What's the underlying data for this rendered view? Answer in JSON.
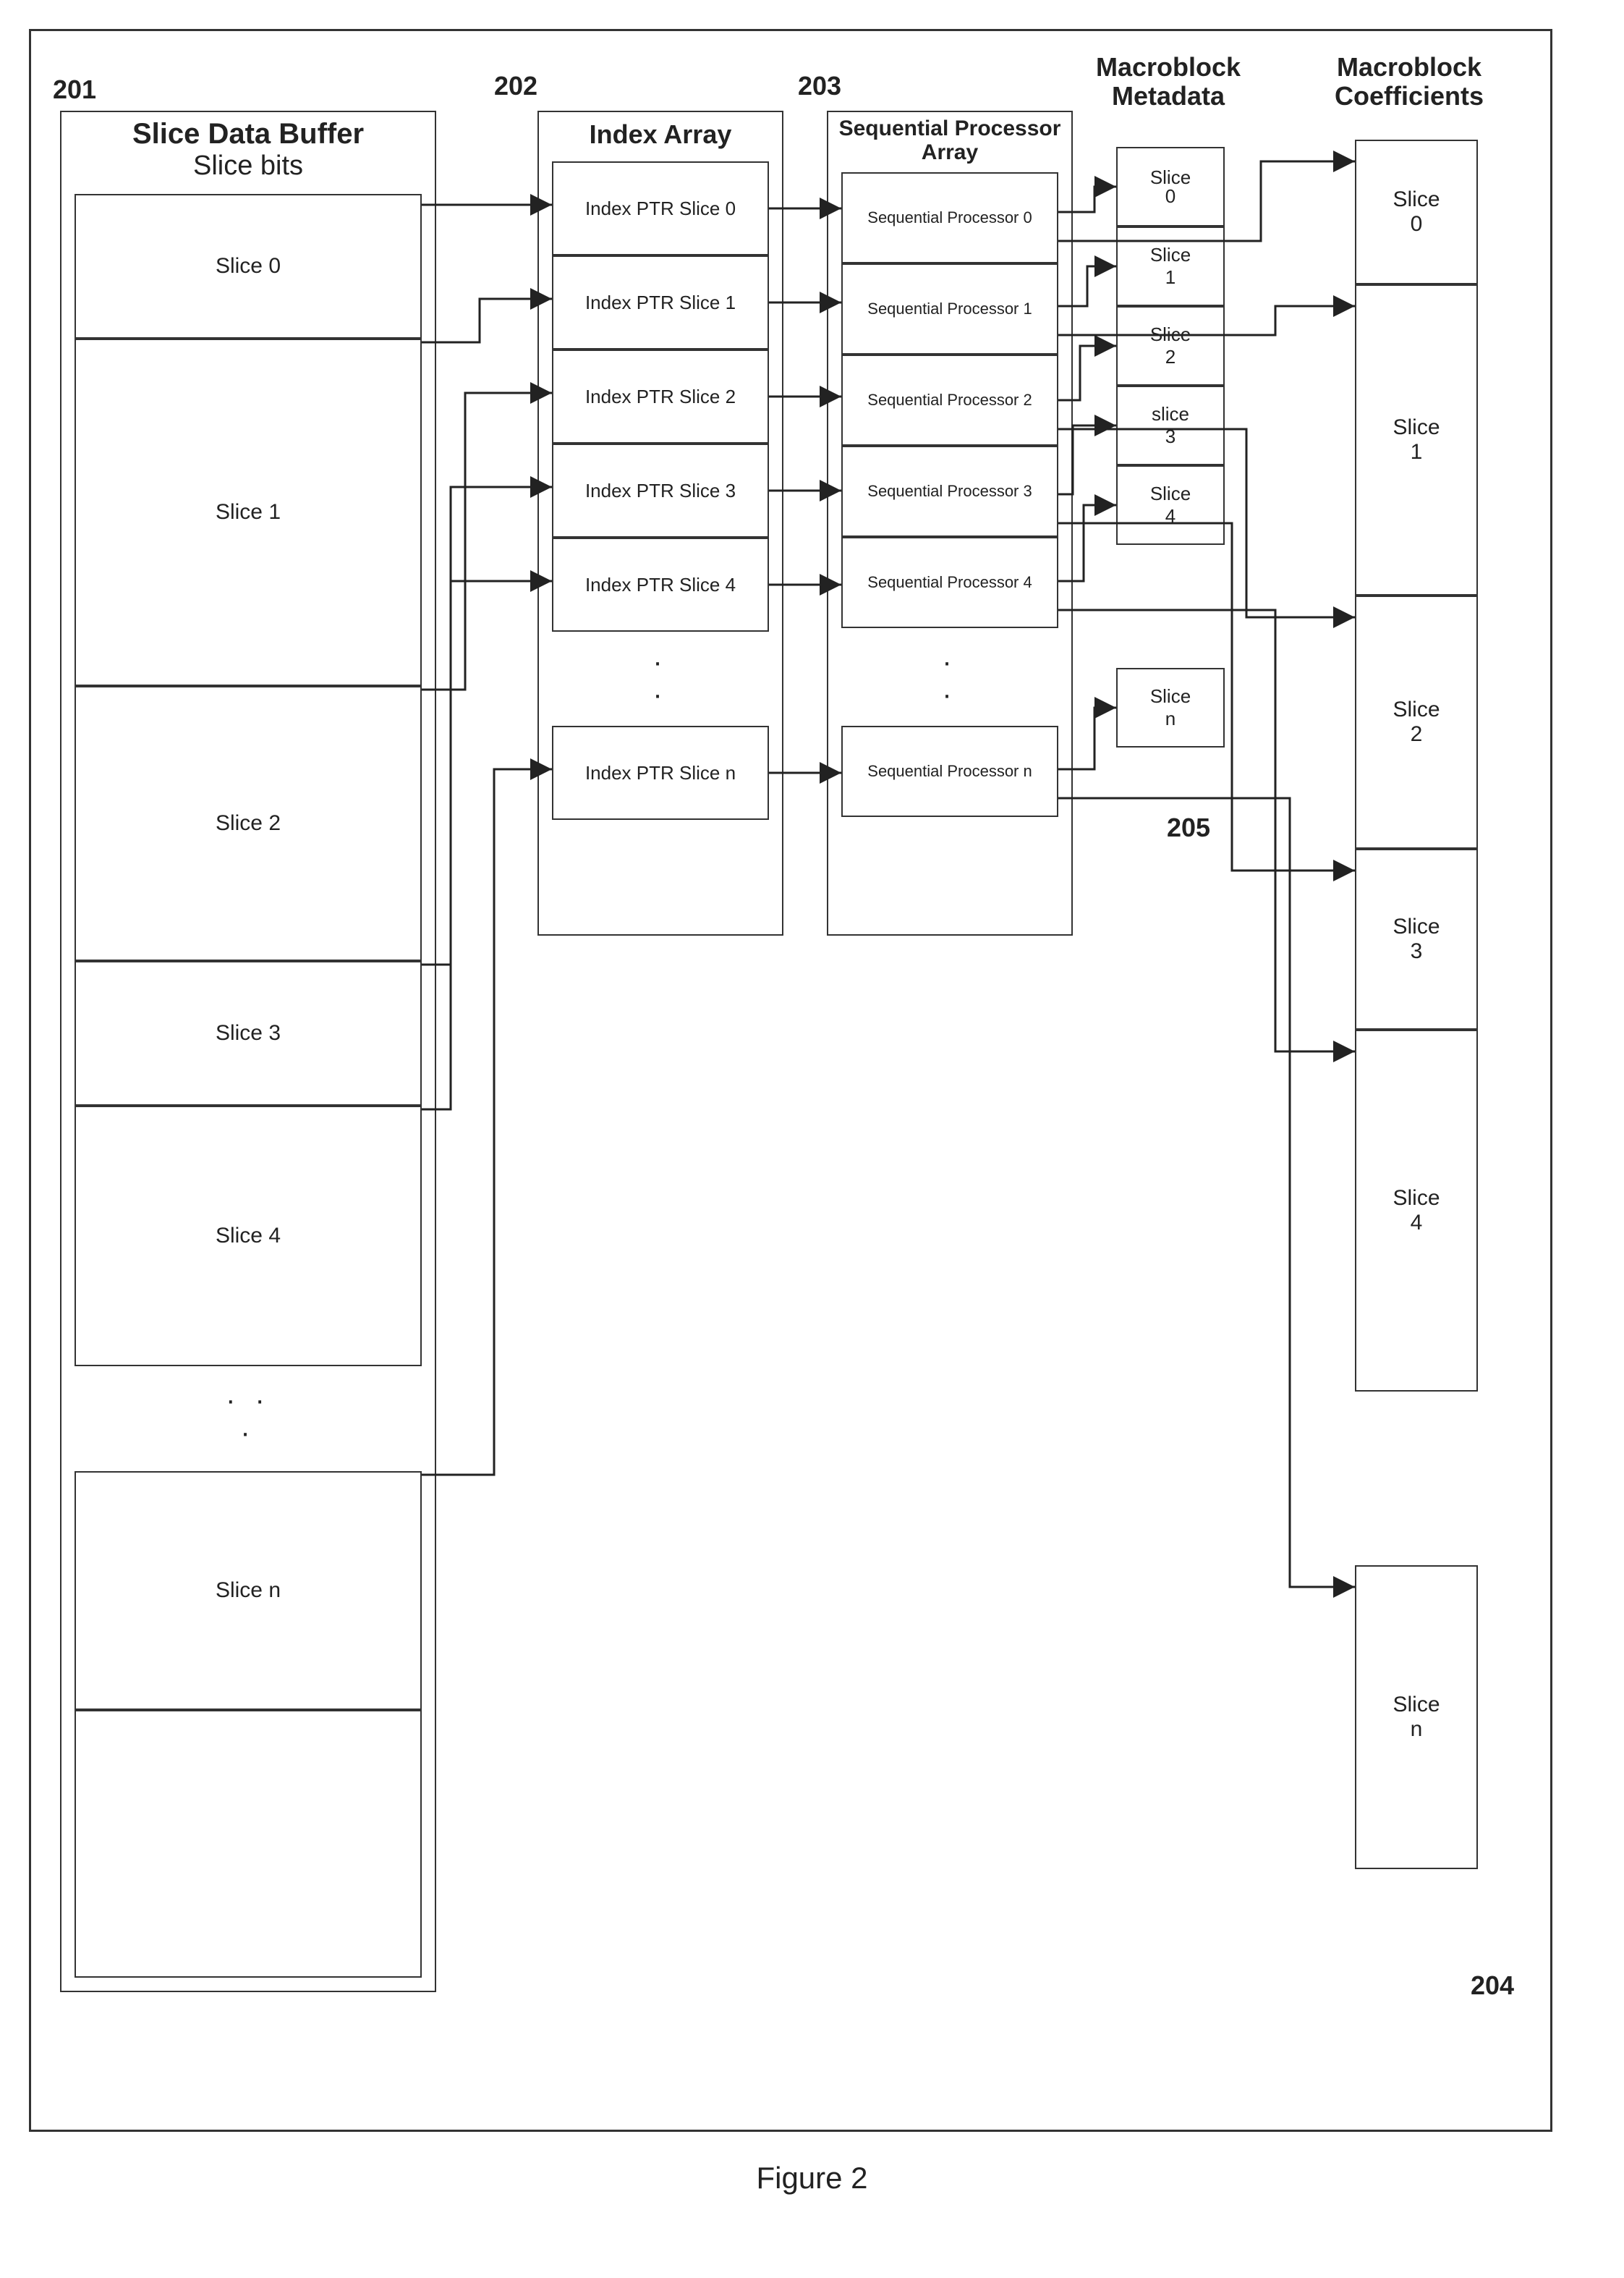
{
  "figure_label": "Figure 2",
  "refs": {
    "slice_buffer": "201",
    "index_array": "202",
    "seq_array": "203",
    "metadata": "205",
    "coeffs": "204"
  },
  "blocks": {
    "slice_buffer": {
      "title": "Slice Data Buffer",
      "subtitle": "Slice bits",
      "items": [
        "Slice 0",
        "Slice 1",
        "Slice 2",
        "Slice 3",
        "Slice 4",
        "Slice n"
      ]
    },
    "index_array": {
      "title": "Index Array",
      "items": [
        "Index PTR Slice 0",
        "Index PTR Slice 1",
        "Index PTR Slice 2",
        "Index PTR Slice 3",
        "Index PTR Slice 4",
        "Index PTR Slice n"
      ]
    },
    "seq_array": {
      "title": "Sequential Processor Array",
      "items": [
        "Sequential Processor 0",
        "Sequential Processor 1",
        "Sequential Processor 2",
        "Sequential Processor 3",
        "Sequential Processor 4",
        "Sequential Processor n"
      ]
    },
    "metadata": {
      "title": "Macroblock Metadata",
      "items": [
        "Slice 0",
        "Slice 1",
        "Slice 2",
        "slice 3",
        "Slice 4",
        "Slice n"
      ]
    },
    "coeffs": {
      "title": "Macroblock Coefficients",
      "items": [
        "Slice 0",
        "Slice 1",
        "Slice 2",
        "Slice 3",
        "Slice 4",
        "Slice n"
      ]
    }
  }
}
